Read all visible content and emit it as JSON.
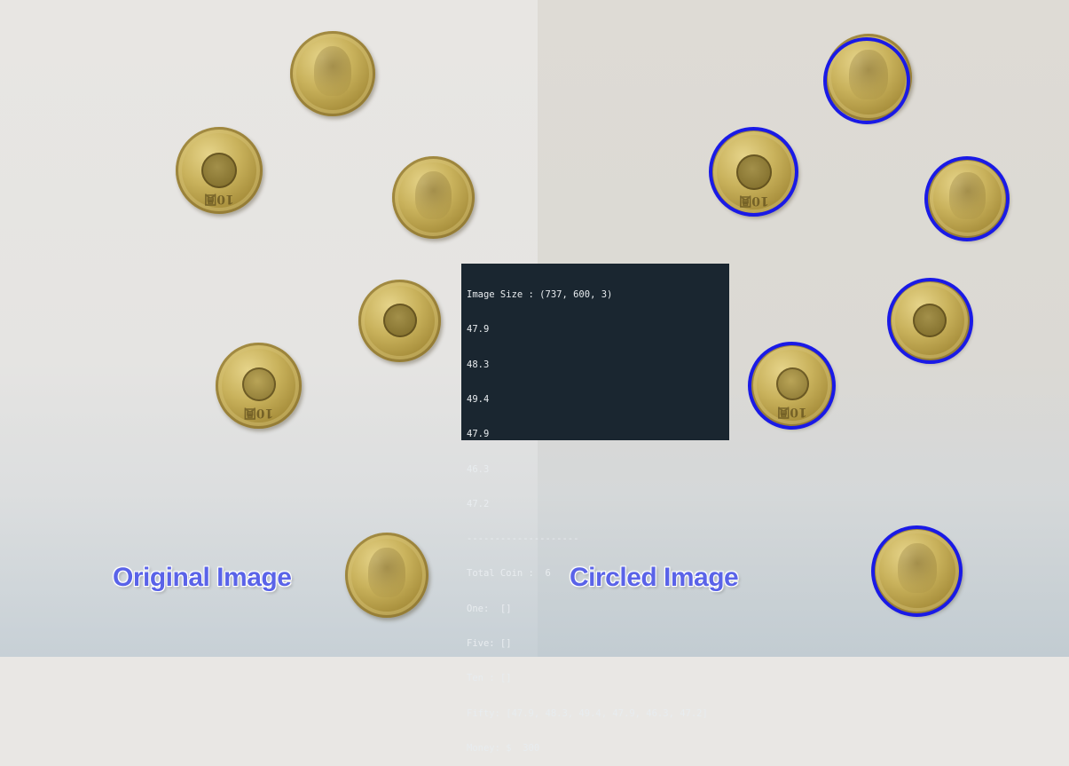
{
  "captions": {
    "left": "Original Image",
    "right": "Circled Image"
  },
  "console": {
    "lines": [
      "Image Size : (737, 600, 3)",
      "47.9",
      "48.3",
      "49.4",
      "47.9",
      "46.3",
      "47.2",
      "--------------------",
      "Total Coin :  6",
      "One:  []",
      "Five: []",
      "Ten : []",
      "Fifty: [47.9, 48.3, 49.4, 47.9, 46.3, 47.2]",
      "Money: $  300"
    ]
  },
  "colors": {
    "circle_outline": "#1a1ae6",
    "caption_text": "#5a63e8",
    "console_bg": "#1a2630"
  },
  "coin_labels": {
    "ten": "10圓"
  }
}
